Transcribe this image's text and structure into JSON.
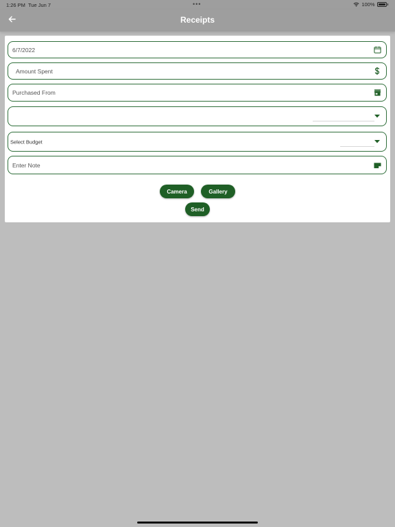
{
  "status_bar": {
    "time": "1:26 PM",
    "date": "Tue Jun 7",
    "dots": "•••",
    "battery": "100%"
  },
  "app_bar": {
    "title": "Receipts",
    "back_icon": "arrow-left-icon"
  },
  "form": {
    "date": {
      "value": "6/7/2022",
      "icon": "calendar-icon"
    },
    "amount": {
      "placeholder": "Amount Spent",
      "icon": "dollar-icon"
    },
    "purchased_from": {
      "placeholder": "Purchased From",
      "icon": "store-icon"
    },
    "category": {
      "value": "",
      "icon": "dropdown-arrow-icon"
    },
    "budget": {
      "value": "Select Budget",
      "icon": "dropdown-arrow-icon"
    },
    "note": {
      "placeholder": "Enter Note",
      "icon": "note-icon"
    }
  },
  "buttons": {
    "camera": "Camera",
    "gallery": "Gallery",
    "send": "Send"
  },
  "colors": {
    "accent": "#1f5f26",
    "field_border": "#2f6e3a",
    "app_bar": "#9e9e9e",
    "background": "#bdbdbd"
  }
}
